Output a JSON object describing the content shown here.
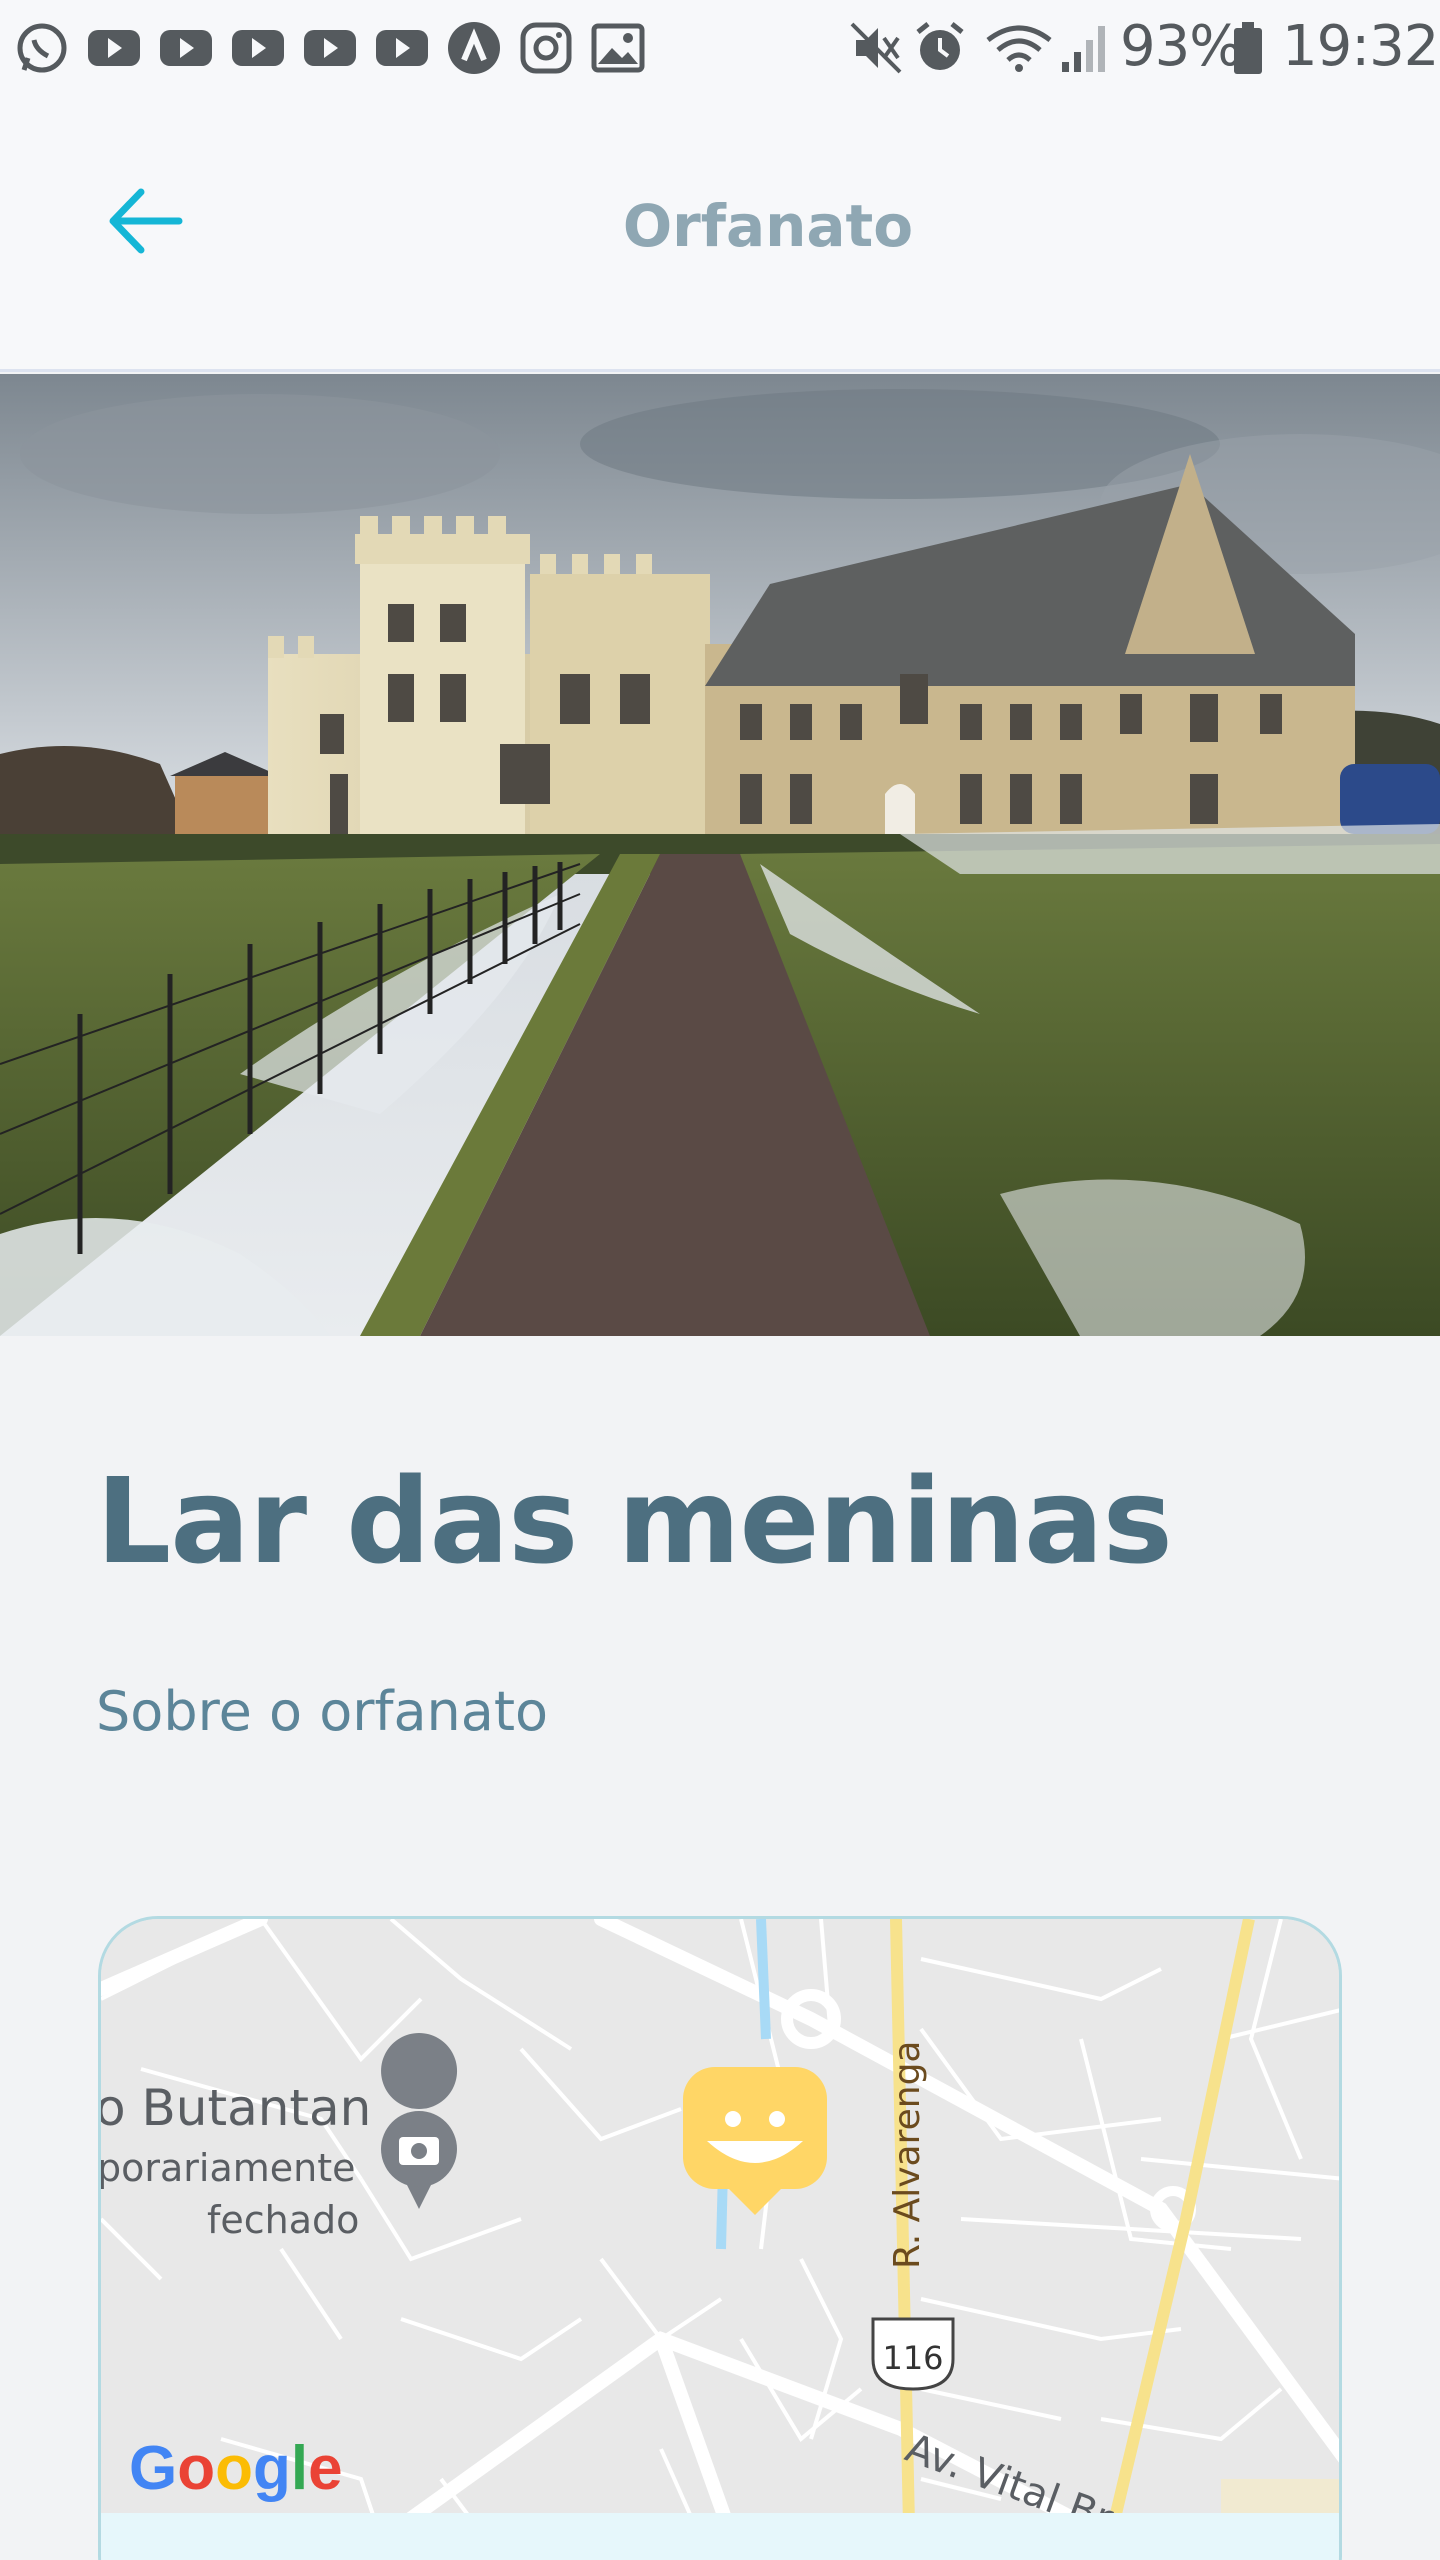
{
  "status_bar": {
    "battery": "93%",
    "time": "19:32"
  },
  "header": {
    "title": "Orfanato"
  },
  "orphanage": {
    "name": "Lar das meninas",
    "about_label": "Sobre o orfanato"
  },
  "map": {
    "labels": {
      "place_name": "o Butantan",
      "place_status_1": "porariamente",
      "place_status_2": "fechado",
      "street_1": "R. Alvarenga",
      "street_2": "Av. Vital Brasil",
      "route_number": "116",
      "logo": "Google"
    }
  },
  "colors": {
    "accent": "#15b6d6",
    "title": "#4d6f80",
    "marker": "#ffd666"
  }
}
